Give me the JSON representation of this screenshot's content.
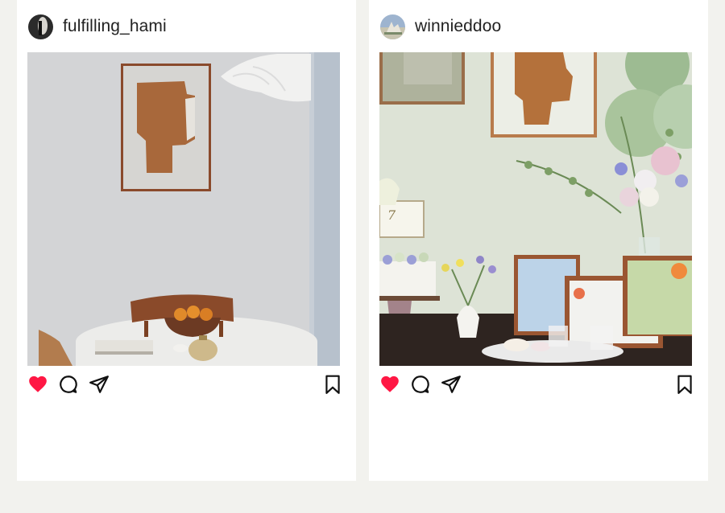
{
  "posts": [
    {
      "username": "fulfilling_hami",
      "liked": true,
      "icons": [
        "heart-icon",
        "comment-icon",
        "share-icon",
        "bookmark-icon"
      ]
    },
    {
      "username": "winnieddoo",
      "liked": true,
      "icons": [
        "heart-icon",
        "comment-icon",
        "share-icon",
        "bookmark-icon"
      ]
    }
  ],
  "colors": {
    "background": "#f2f2ee",
    "card": "#ffffff",
    "like": "#ff1744"
  }
}
